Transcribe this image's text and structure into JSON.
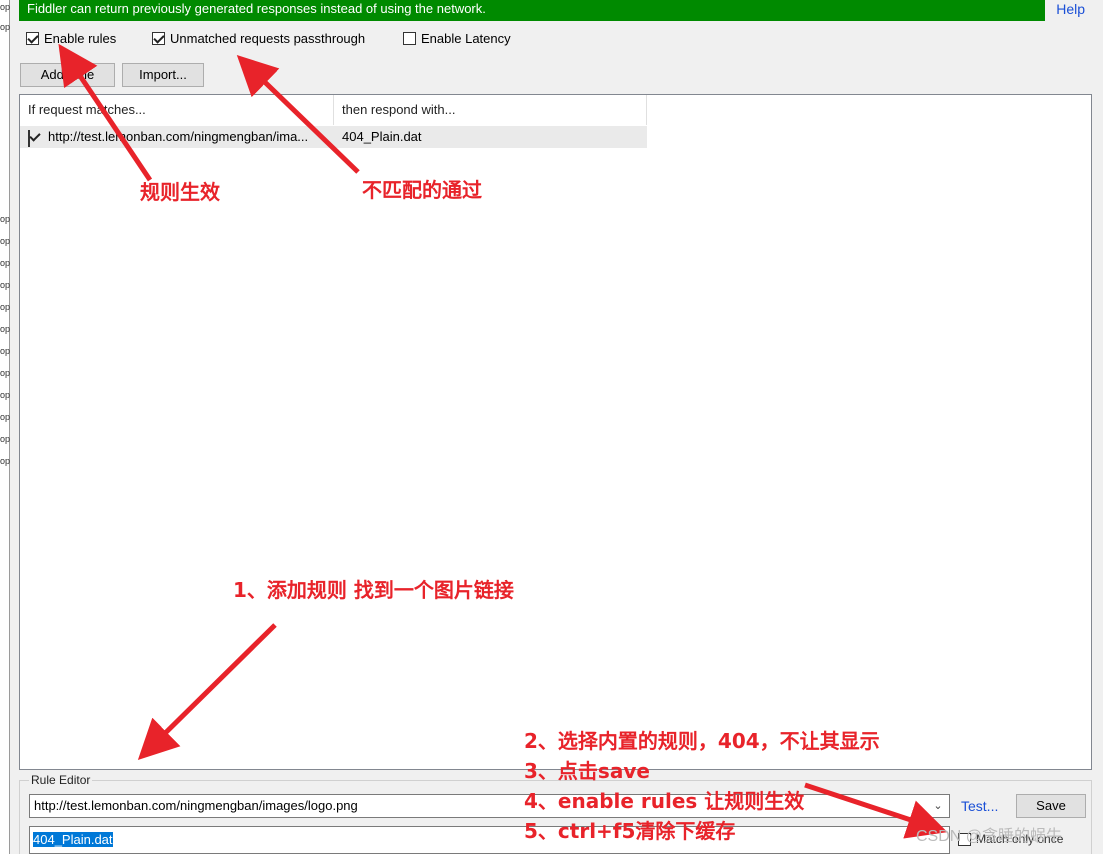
{
  "banner": {
    "text": "Fiddler can return previously generated responses instead of using the network.",
    "help": "Help",
    "color": "#008a00"
  },
  "options": {
    "enable_rules": {
      "label": "Enable rules",
      "checked": true
    },
    "unmatched_passthrough": {
      "label": "Unmatched requests passthrough",
      "checked": true
    },
    "enable_latency": {
      "label": "Enable Latency",
      "checked": false
    }
  },
  "toolbar": {
    "add_rule": "Add Rule",
    "import": "Import..."
  },
  "rules_list": {
    "columns": [
      "If request matches...",
      "then respond with..."
    ],
    "rows": [
      {
        "checked": true,
        "match": "http://test.lemonban.com/ningmengban/ima...",
        "respond": "404_Plain.dat"
      }
    ]
  },
  "rule_editor": {
    "label": "Rule Editor",
    "match_value": "http://test.lemonban.com/ningmengban/images/logo.png",
    "respond_value": "404_Plain.dat",
    "test_label": "Test...",
    "save_label": "Save",
    "match_only_once": "Match only once"
  },
  "annotations": {
    "rule_effective": "规则生效",
    "unmatched_pass": "不匹配的通过",
    "step1": "1、添加规则  找到一个图片链接",
    "step2": "2、选择内置的规则，404，不让其显示",
    "step3": "3、点击save",
    "step4": "4、enable rules 让规则生效",
    "step5": "5、ctrl+f5清除下缓存",
    "color": "#e8232a"
  },
  "watermark": "CSDN @贪睡的蜗牛"
}
